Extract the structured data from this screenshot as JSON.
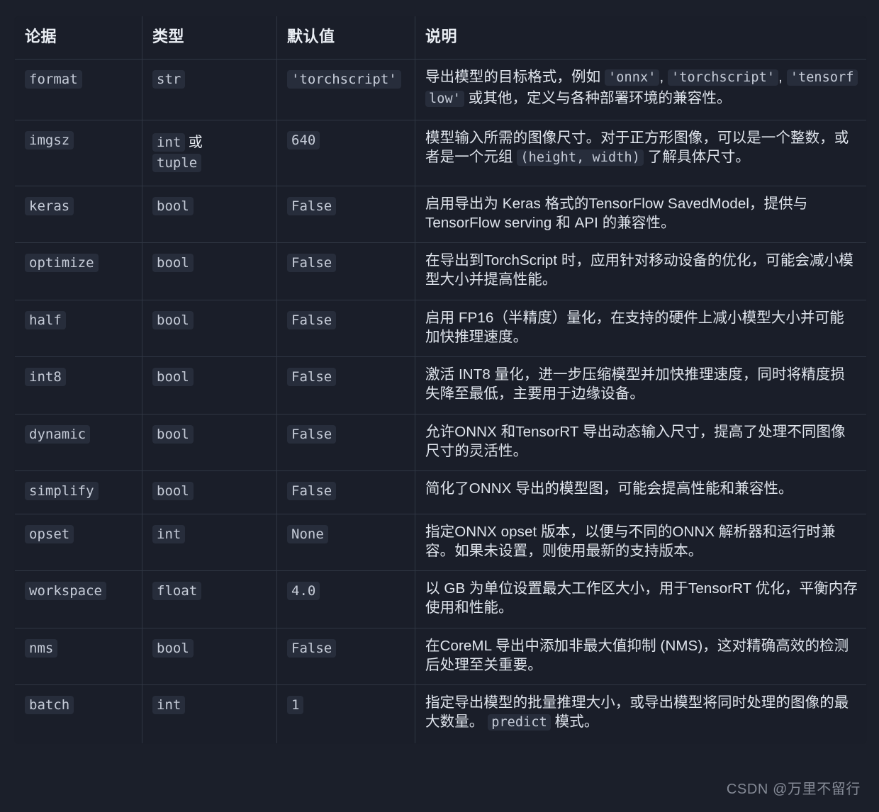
{
  "table": {
    "headers": [
      "论据",
      "类型",
      "默认值",
      "说明"
    ],
    "rows": [
      {
        "arg": "format",
        "type": "str",
        "type_suffix": "",
        "default": "'torchscript'",
        "desc_parts": [
          {
            "t": "text",
            "v": "导出模型的目标格式，例如 "
          },
          {
            "t": "code",
            "v": "'onnx'"
          },
          {
            "t": "text",
            "v": ", "
          },
          {
            "t": "code",
            "v": "'torchscript'"
          },
          {
            "t": "text",
            "v": ", "
          },
          {
            "t": "code",
            "v": "'tensorflow'"
          },
          {
            "t": "text",
            "v": " 或其他，定义与各种部署环境的兼容性。"
          }
        ]
      },
      {
        "arg": "imgsz",
        "type": "int",
        "type_suffix": "或",
        "type_second": "tuple",
        "default": "640",
        "desc_parts": [
          {
            "t": "text",
            "v": "模型输入所需的图像尺寸。对于正方形图像，可以是一个整数，或者是一个元组 "
          },
          {
            "t": "code",
            "v": "(height, width)"
          },
          {
            "t": "text",
            "v": " 了解具体尺寸。"
          }
        ]
      },
      {
        "arg": "keras",
        "type": "bool",
        "default": "False",
        "desc_parts": [
          {
            "t": "text",
            "v": "启用导出为 Keras 格式的TensorFlow SavedModel，提供与TensorFlow serving 和 API 的兼容性。"
          }
        ]
      },
      {
        "arg": "optimize",
        "type": "bool",
        "default": "False",
        "desc_parts": [
          {
            "t": "text",
            "v": "在导出到TorchScript 时，应用针对移动设备的优化，可能会减小模型大小并提高性能。"
          }
        ]
      },
      {
        "arg": "half",
        "type": "bool",
        "default": "False",
        "desc_parts": [
          {
            "t": "text",
            "v": "启用 FP16（半精度）量化，在支持的硬件上减小模型大小并可能加快推理速度。"
          }
        ]
      },
      {
        "arg": "int8",
        "type": "bool",
        "default": "False",
        "desc_parts": [
          {
            "t": "text",
            "v": "激活 INT8 量化，进一步压缩模型并加快推理速度，同时将精度损失降至最低，主要用于边缘设备。"
          }
        ]
      },
      {
        "arg": "dynamic",
        "type": "bool",
        "default": "False",
        "desc_parts": [
          {
            "t": "text",
            "v": "允许ONNX 和TensorRT 导出动态输入尺寸，提高了处理不同图像尺寸的灵活性。"
          }
        ]
      },
      {
        "arg": "simplify",
        "type": "bool",
        "default": "False",
        "desc_parts": [
          {
            "t": "text",
            "v": "简化了ONNX 导出的模型图，可能会提高性能和兼容性。"
          }
        ]
      },
      {
        "arg": "opset",
        "type": "int",
        "default": "None",
        "desc_parts": [
          {
            "t": "text",
            "v": "指定ONNX opset 版本，以便与不同的ONNX 解析器和运行时兼容。如果未设置，则使用最新的支持版本。"
          }
        ]
      },
      {
        "arg": "workspace",
        "type": "float",
        "default": "4.0",
        "desc_parts": [
          {
            "t": "text",
            "v": "以 GB 为单位设置最大工作区大小，用于TensorRT 优化，平衡内存使用和性能。"
          }
        ]
      },
      {
        "arg": "nms",
        "type": "bool",
        "default": "False",
        "desc_parts": [
          {
            "t": "text",
            "v": "在CoreML 导出中添加非最大值抑制 (NMS)，这对精确高效的检测后处理至关重要。"
          }
        ]
      },
      {
        "arg": "batch",
        "type": "int",
        "default": "1",
        "desc_parts": [
          {
            "t": "text",
            "v": "指定导出模型的批量推理大小，或导出模型将同时处理的图像的最大数量。 "
          },
          {
            "t": "code",
            "v": "predict"
          },
          {
            "t": "text",
            "v": " 模式。"
          }
        ]
      }
    ]
  },
  "watermark": "CSDN @万里不留行",
  "colors": {
    "page_background": "#1b1f2a",
    "table_background": "#1a1e29",
    "border": "#2f3643",
    "chip_background": "#272d3b",
    "header_text": "#e9edf3",
    "body_text": "#dfe4ec",
    "code_text": "#c6ccd8",
    "watermark_text": "#8d939f"
  }
}
